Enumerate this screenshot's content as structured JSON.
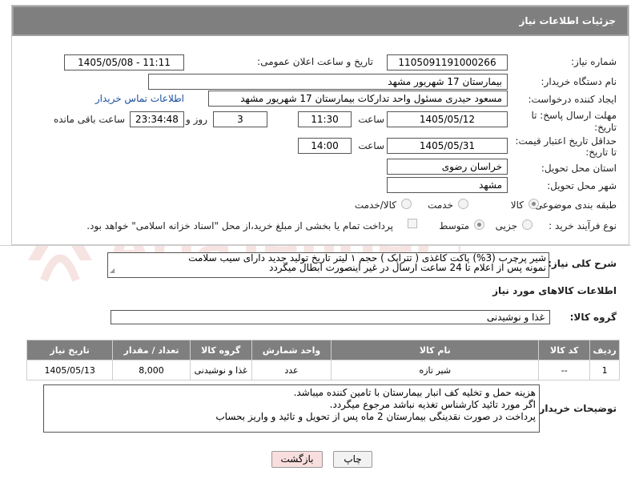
{
  "header": {
    "title": "جزئیات اطلاعات نیاز"
  },
  "need_number": {
    "label": "شماره نیاز:",
    "value": "1105091191000266"
  },
  "announce": {
    "label": "تاریخ و ساعت اعلان عمومی:",
    "value": "1405/05/08 - 11:11"
  },
  "buyer_org": {
    "label": "نام دستگاه خریدار:",
    "value": "بیمارستان 17 شهریور مشهد"
  },
  "creator": {
    "label": "ایجاد کننده درخواست:",
    "value": "مسعود حیدری مسئول واحد تدارکات  بیمارستان 17 شهریور مشهد",
    "contact_link": "اطلاعات تماس خریدار"
  },
  "deadline": {
    "label_line1": "مهلت ارسال پاسخ: تا",
    "label_line2": "تاریخ:",
    "date": "1405/05/12",
    "time_label": "ساعت",
    "time": "11:30",
    "days": "3",
    "days_label": "روز و",
    "remaining": "23:34:48",
    "remaining_label": "ساعت باقی مانده"
  },
  "validity": {
    "label_line1": "حداقل تاریخ اعتبار قیمت:",
    "label_line2": "تا تاریخ:",
    "date": "1405/05/31",
    "time_label": "ساعت",
    "time": "14:00"
  },
  "province": {
    "label": "استان محل تحویل:",
    "value": "خراسان رضوی"
  },
  "city": {
    "label": "شهر محل تحویل:",
    "value": "مشهد"
  },
  "category": {
    "label": "طبقه بندی موضوعی:",
    "options": [
      "کالا",
      "خدمت",
      "کالا/خدمت"
    ],
    "selected": "کالا"
  },
  "process": {
    "label": "نوع فرآیند خرید :",
    "options": [
      "جزیی",
      "متوسط"
    ],
    "selected": "متوسط",
    "payment_note": "پرداخت تمام یا بخشی از مبلغ خرید،از محل \"اسناد خزانه اسلامی\" خواهد بود."
  },
  "general_desc": {
    "label": "شرح کلی نیاز:",
    "line1": "شیر پرچرب (3%) پاکت کاغذی ( تتراپک ) حجم ۱ لیتر تاریخ تولید جدید دارای سیب سلامت",
    "line2": "نمونه پس از اعلام تا 24 ساعت  ارسال در غیر اینصورت ابطال میگردد"
  },
  "goods_info": {
    "title": "اطلاعات کالاهای مورد نیاز"
  },
  "goods_group": {
    "label": "گروه کالا:",
    "value": "غذا و نوشیدنی"
  },
  "table": {
    "headers": [
      "ردیف",
      "کد کالا",
      "نام کالا",
      "واحد شمارش",
      "گروه کالا",
      "تعداد / مقدار",
      "تاریخ نیاز"
    ],
    "rows": [
      [
        "1",
        "--",
        "شیر تازه",
        "عدد",
        "غذا و نوشیدنی",
        "8,000",
        "1405/05/13"
      ]
    ]
  },
  "buyer_notes": {
    "label": "توضیحات خریدار:",
    "line1": "هزینه حمل و تخلیه کف انبار بیمارستان با تامین کننده میباشد.",
    "line2": "اگر مورد تائید کارشناس تغذیه نباشد مرجوع میگردد.",
    "line3": "پرداخت در صورت نقدینگی بیمارستان 2 ماه پس از تحویل و تائید و واریز بحساب"
  },
  "buttons": {
    "print": "چاپ",
    "back": "بازگشت"
  },
  "watermark": {
    "text": "AriaTender.neT"
  },
  "colors": {
    "header_bg": "#7f7f7f",
    "link": "#1a4f9c",
    "back_button_bg": "#f9dede"
  }
}
